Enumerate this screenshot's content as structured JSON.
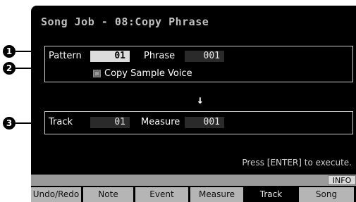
{
  "header": {
    "title": "Song Job - 08:Copy Phrase"
  },
  "source": {
    "pattern_label": "Pattern",
    "pattern_value": "01",
    "phrase_label": "Phrase",
    "phrase_value": "001",
    "copy_sample_voice_label": "Copy Sample Voice",
    "copy_sample_voice_checked": false
  },
  "direction_arrow": "↓",
  "destination": {
    "track_label": "Track",
    "track_value": "01",
    "measure_label": "Measure",
    "measure_value": "001"
  },
  "hint_text": "Press [ENTER] to execute.",
  "info_button": "INFO",
  "tabs": [
    {
      "label": "Undo/Redo",
      "active": false
    },
    {
      "label": "Note",
      "active": false
    },
    {
      "label": "Event",
      "active": false
    },
    {
      "label": "Measure",
      "active": false
    },
    {
      "label": "Track",
      "active": true
    },
    {
      "label": "Song",
      "active": false
    }
  ],
  "callouts": [
    "1",
    "2",
    "3"
  ],
  "colors": {
    "screen_bg": "#000000",
    "selected_field": "#dcdcdc",
    "tab_bg": "#b5b5b5",
    "info_bar": "#9a9a9a"
  }
}
